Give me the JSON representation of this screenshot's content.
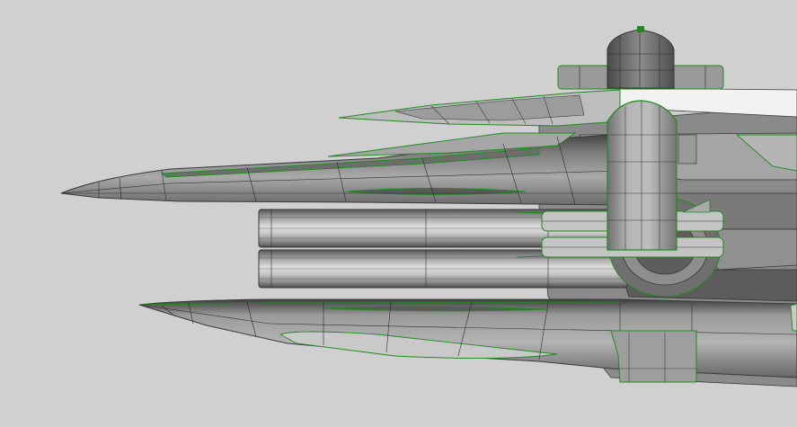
{
  "viewport": {
    "background": "#d0d0d0",
    "wire_color": "#1f8a1f",
    "edge_color": "#3a3a3a",
    "shade_dark": "#555555",
    "shade_mid": "#8a8a8a",
    "shade_light": "#b9b9b9",
    "shade_white": "#f0f0f0"
  }
}
